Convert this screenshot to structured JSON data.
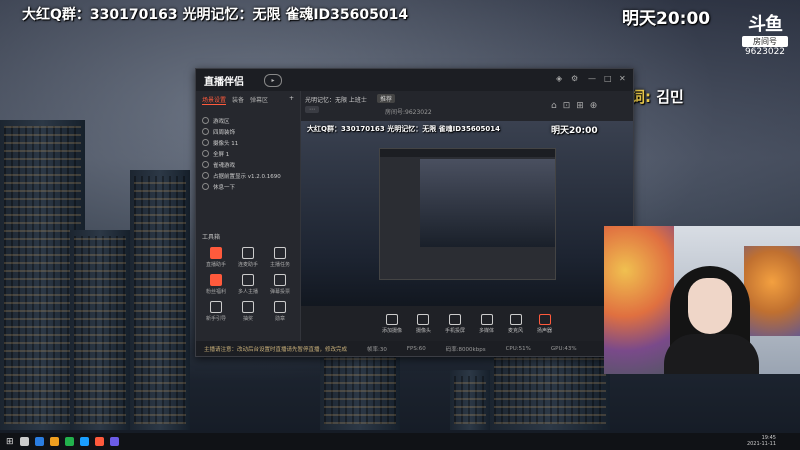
{
  "overlay": {
    "top_left": "大红Q群：330170163 光明记忆：无限 雀魂ID35605014",
    "top_right": "明天20:00",
    "lyric_label": "词:",
    "lyric_value": "김민"
  },
  "douyu_logo": {
    "mark": "斗鱼",
    "tag": "房间号",
    "room": "9623022"
  },
  "app": {
    "brand": "直播伴侣",
    "sidebar_tabs": [
      "场景设置",
      "装备",
      "弹幕区"
    ],
    "layers": [
      "游戏区",
      "四周装饰",
      "摄像头 11",
      "全屏 1",
      "雀魂游戏",
      "占据前置显示 v1.2.0.1690",
      "休息一下"
    ],
    "tools_title": "工具箱",
    "tools": [
      "直播助手",
      "连麦助手",
      "主播任务",
      "粉丝福利",
      "多人主播",
      "弹幕投票",
      "新手引导",
      "抽奖",
      "勋章"
    ],
    "header_title": "光明记忆：无限 上班士",
    "header_badge": "推荐",
    "room_label": "房间号:9623022",
    "bottom_items": [
      "添加摄像",
      "摄像头",
      "手机投屏",
      "多媒体",
      "麦克风",
      "扬声器"
    ],
    "status_warn": "主播请注意：改动后台设置时直播请先暂停直播，修改完成",
    "status_items": [
      "帧率:30",
      "FPS:60",
      "码率:8000kbps",
      "CPU:51%",
      "GPU:43%"
    ]
  },
  "preview": {
    "top_left": "大红Q群：330170163 光明记忆：无限 雀魂ID35605014",
    "top_right": "明天20:00"
  },
  "taskbar": {
    "time": "19:45",
    "date": "2021-11-11"
  }
}
